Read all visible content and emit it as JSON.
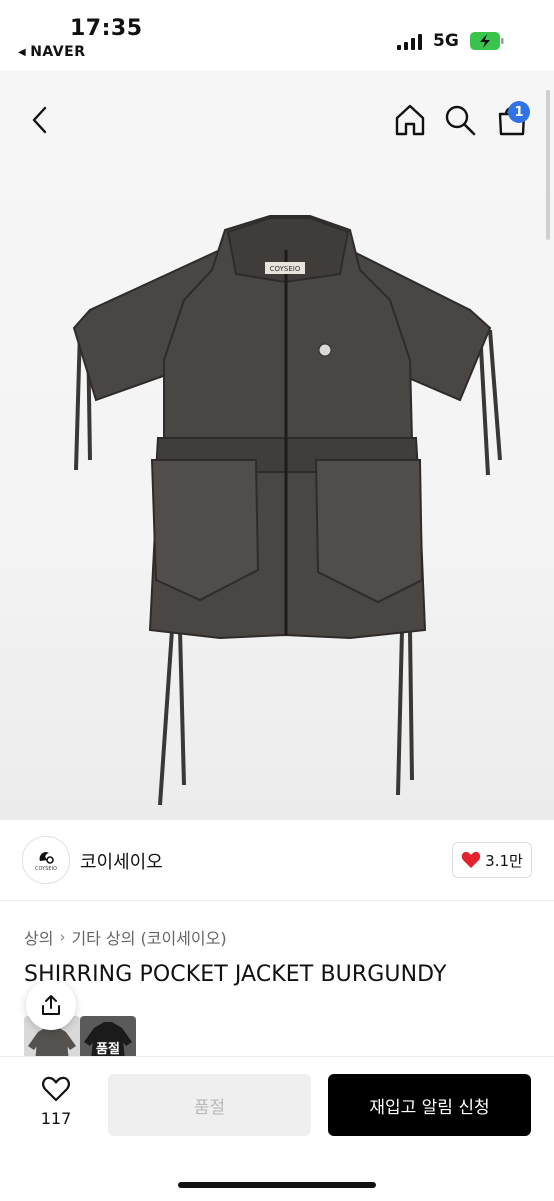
{
  "status_bar": {
    "time": "17:35",
    "back_app": "NAVER",
    "network": "5G"
  },
  "nav": {
    "back_icon": "chevron-left-icon",
    "home_icon": "home-icon",
    "search_icon": "search-icon",
    "cart_icon": "cart-icon",
    "cart_count": "1"
  },
  "seller": {
    "name": "코이세이오",
    "logo_text": "COYSEIO",
    "likes": "3.1만"
  },
  "breadcrumb": {
    "category": "상의",
    "subcategory": "기타 상의 (코이세이오)"
  },
  "product": {
    "title": "SHIRRING POCKET JACKET BURGUNDY",
    "jacket_label": "COYSEIO"
  },
  "thumbnails": [
    {
      "label": ""
    },
    {
      "label": "품절"
    }
  ],
  "actions": {
    "wish_count": "117",
    "soldout_label": "품절",
    "restock_label": "재입고 알림 신청"
  },
  "colors": {
    "accent_blue": "#2f73e6",
    "heart_red": "#e5232f",
    "primary_button": "#000000",
    "disabled_button": "#efefef"
  }
}
